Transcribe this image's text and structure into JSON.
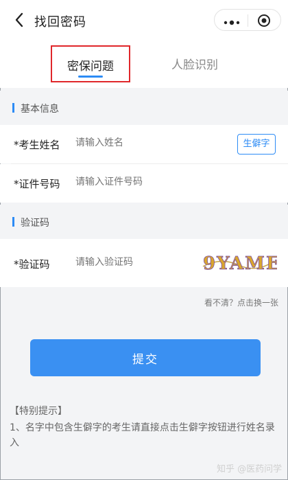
{
  "header": {
    "title": "找回密码",
    "back_icon": "chevron-left-icon",
    "more_icon": "more-dots-icon",
    "close_icon": "target-icon"
  },
  "tabs": [
    {
      "label": "密保问题",
      "active": true
    },
    {
      "label": "人脸识别",
      "active": false
    }
  ],
  "sections": {
    "basic_info": "基本信息",
    "captcha": "验证码"
  },
  "form": {
    "name_label": "*考生姓名",
    "name_placeholder": "请输入姓名",
    "rare_char_button": "生僻字",
    "id_label": "*证件号码",
    "id_placeholder": "请输入证件号码",
    "captcha_label": "*验证码",
    "captcha_placeholder": "请输入验证码",
    "captcha_image_text": "9YAME",
    "refresh_text": "看不清？点击换一张"
  },
  "submit_label": "提交",
  "notice": {
    "title": "【特别提示】",
    "body": "1、名字中包含生僻字的考生请直接点击生僻字按钮进行姓名录入"
  },
  "watermark": "知乎 @医药问学",
  "colors": {
    "accent": "#2c8bf5",
    "submit_bg": "#3a90f2",
    "highlight_border": "#e0262a",
    "page_bg": "#f3f4f6"
  }
}
